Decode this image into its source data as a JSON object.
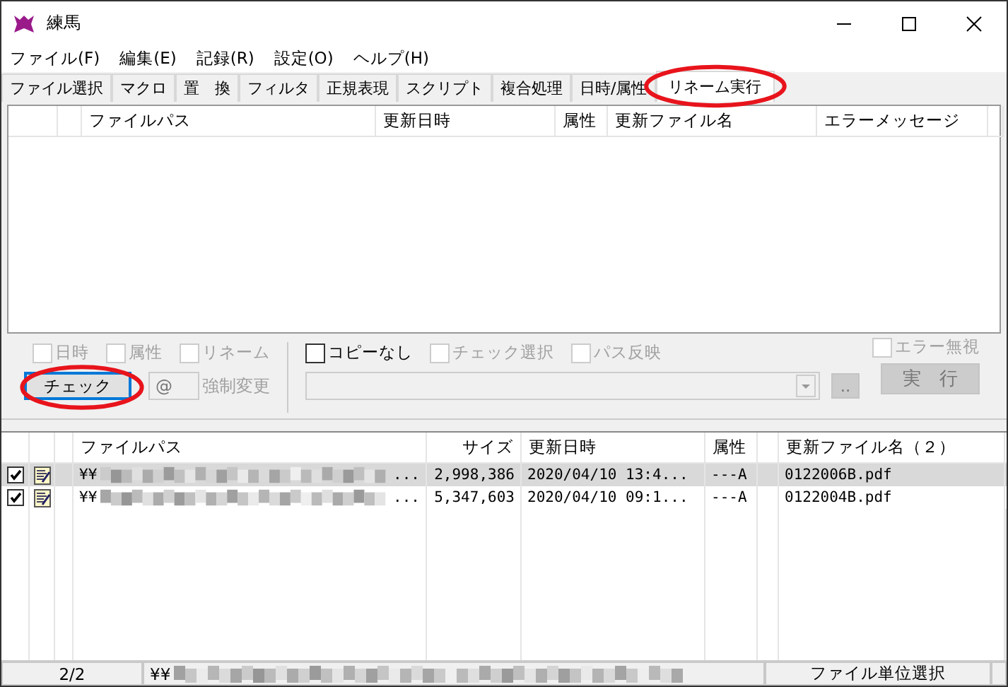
{
  "window": {
    "title": "練馬"
  },
  "menu": [
    "ファイル(F)",
    "編集(E)",
    "記録(R)",
    "設定(O)",
    "ヘルプ(H)"
  ],
  "tabs": [
    {
      "label": "ファイル選択",
      "selected": false,
      "highlighted": false
    },
    {
      "label": "マクロ",
      "selected": false,
      "highlighted": false
    },
    {
      "label": "置　換",
      "selected": false,
      "highlighted": false
    },
    {
      "label": "フィルタ",
      "selected": false,
      "highlighted": false
    },
    {
      "label": "正規表現",
      "selected": false,
      "highlighted": false
    },
    {
      "label": "スクリプト",
      "selected": false,
      "highlighted": false
    },
    {
      "label": "複合処理",
      "selected": false,
      "highlighted": false
    },
    {
      "label": "日時/属性",
      "selected": false,
      "highlighted": false
    },
    {
      "label": "リネーム実行",
      "selected": true,
      "highlighted": true
    }
  ],
  "result_list": {
    "columns": [
      "ファイルパス",
      "更新日時",
      "属性",
      "更新ファイル名",
      "エラーメッセージ"
    ]
  },
  "options": {
    "left_checkboxes": [
      {
        "label": "日時",
        "checked": false,
        "disabled": true
      },
      {
        "label": "属性",
        "checked": false,
        "disabled": true
      },
      {
        "label": "リネーム",
        "checked": false,
        "disabled": true
      }
    ],
    "check_button": {
      "label": "チェック",
      "highlighted": true
    },
    "marker_field": {
      "value": "@",
      "disabled": true
    },
    "force_change": {
      "label": "強制変更",
      "disabled": true
    },
    "right_checkboxes": [
      {
        "label": "コピーなし",
        "checked": false,
        "disabled": false
      },
      {
        "label": "チェック選択",
        "checked": false,
        "disabled": true
      },
      {
        "label": "パス反映",
        "checked": false,
        "disabled": true
      }
    ],
    "ignore_errors": {
      "label": "エラー無視",
      "checked": false,
      "disabled": true
    },
    "path_combo": {
      "disabled": true
    },
    "browse_button": {
      "label": "..",
      "disabled": true
    },
    "run_button": {
      "label": "実　行",
      "disabled": true
    }
  },
  "files": {
    "columns": [
      "ファイルパス",
      "サイズ",
      "更新日時",
      "属性",
      "更新ファイル名（２）"
    ],
    "rows": [
      {
        "checked": true,
        "selected": true,
        "path_start": "¥¥",
        "path_end": "...",
        "size": "2,998,386",
        "modified": "2020/04/10 13:4...",
        "attributes": "---A",
        "new_name": "0122006B.pdf"
      },
      {
        "checked": true,
        "selected": false,
        "path_start": "¥¥",
        "path_end": "...",
        "size": "5,347,603",
        "modified": "2020/04/10 09:1...",
        "attributes": "---A",
        "new_name": "0122004B.pdf"
      }
    ]
  },
  "status_bar": {
    "count": "2/2",
    "path_start": "¥¥",
    "mode": "ファイル単位選択"
  }
}
